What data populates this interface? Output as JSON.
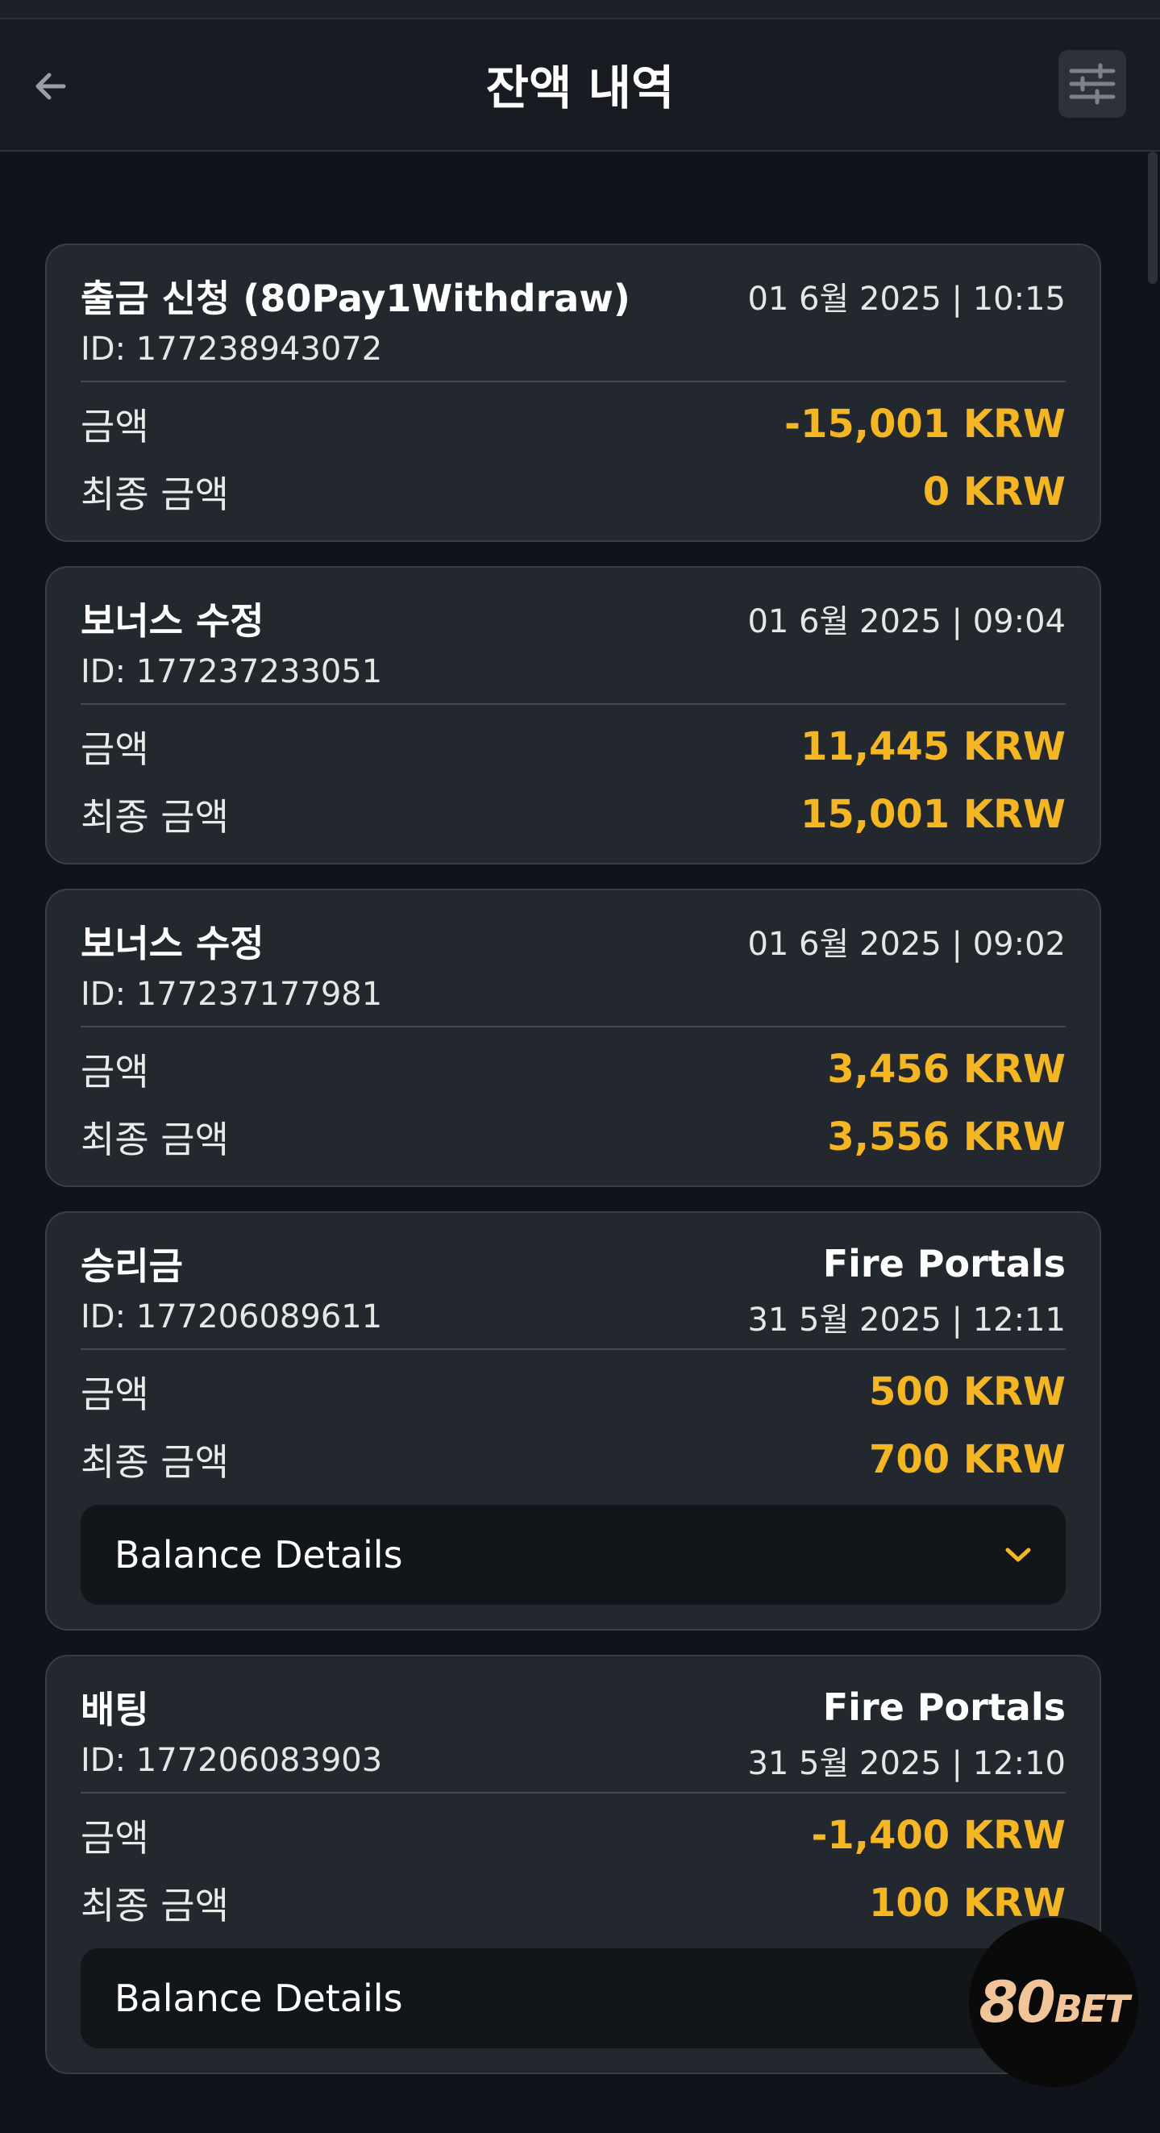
{
  "header": {
    "title": "잔액 내역",
    "back_icon": "arrow-left-icon",
    "filter_icon": "sliders-icon"
  },
  "colors": {
    "background": "#10141a",
    "card": "#23272e",
    "accent": "#f5b624"
  },
  "labels": {
    "amount": "금액",
    "final_amount": "최종 금액",
    "balance_details": "Balance Details"
  },
  "transactions": [
    {
      "title": "출금 신청 (80Pay1Withdraw)",
      "datetime": "01 6월 2025 | 10:15",
      "id": "ID: 177238943072",
      "amount": "-15,001 KRW",
      "final_amount": "0 KRW"
    },
    {
      "title": "보너스 수정",
      "datetime": "01 6월 2025 | 09:04",
      "id": "ID: 177237233051",
      "amount": "11,445 KRW",
      "final_amount": "15,001 KRW"
    },
    {
      "title": "보너스 수정",
      "datetime": "01 6월 2025 | 09:02",
      "id": "ID: 177237177981",
      "amount": "3,456 KRW",
      "final_amount": "3,556 KRW"
    },
    {
      "title": "승리금",
      "game": "Fire Portals",
      "id": "ID: 177206089611",
      "datetime": "31 5월 2025 | 12:11",
      "amount": "500 KRW",
      "final_amount": "700 KRW"
    },
    {
      "title": "배팅",
      "game": "Fire Portals",
      "id": "ID: 177206083903",
      "datetime": "31 5월 2025 | 12:10",
      "amount": "-1,400 KRW",
      "final_amount": "100 KRW"
    }
  ],
  "logo": {
    "text_main": "80",
    "text_small": "BET"
  }
}
